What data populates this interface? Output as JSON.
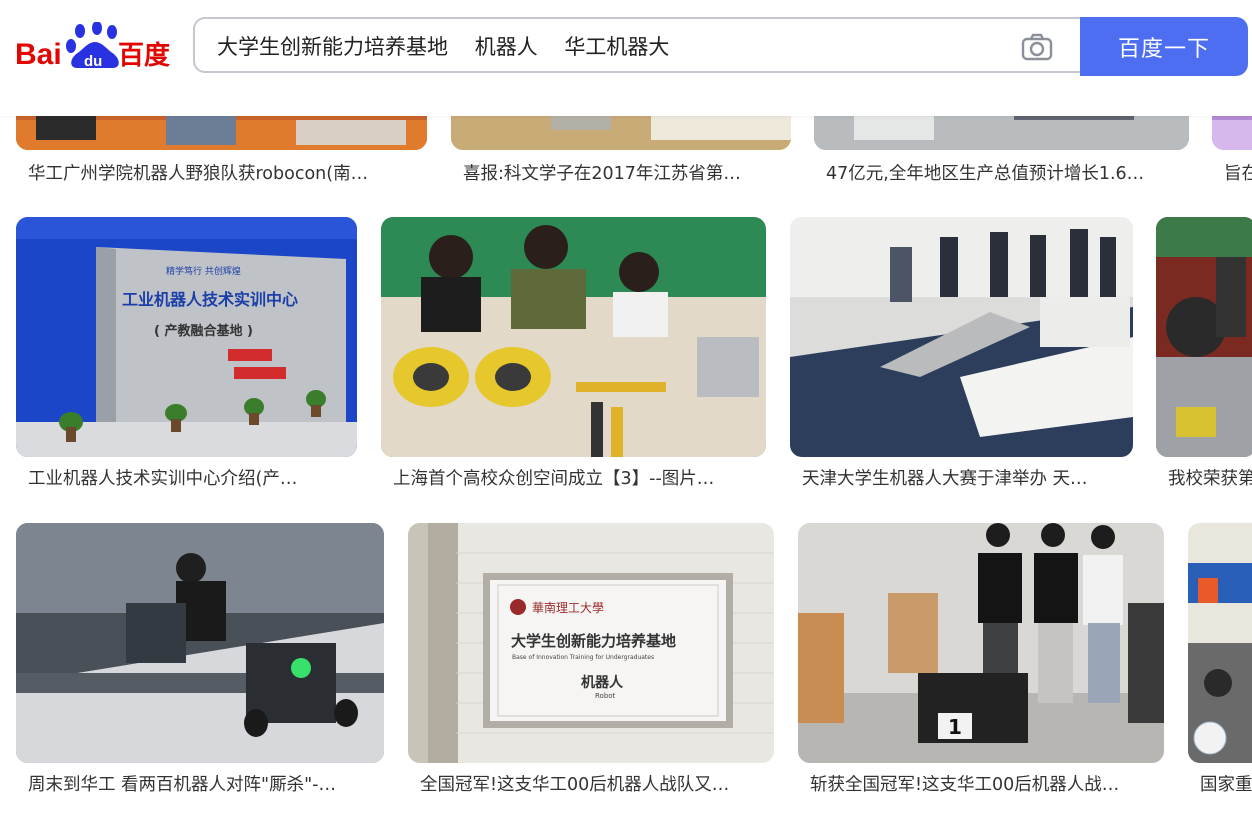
{
  "header": {
    "logo_text_left": "Bai",
    "logo_text_du": "du",
    "logo_text_right": "百度",
    "query": "大学生创新能力培养基地    机器人    华工机器大",
    "search_button": "百度一下",
    "camera_icon": "camera-icon"
  },
  "row1": [
    {
      "caption": "华工广州学院机器人野狼队获robocon(南…"
    },
    {
      "caption": "喜报:科文学子在2017年江苏省第…"
    },
    {
      "caption": "47亿元,全年地区生产总值预计增长1.6…"
    },
    {
      "caption": "旨在"
    }
  ],
  "row2": [
    {
      "caption": "工业机器人技术实训中心介绍(产…",
      "sign_line1": "工业机器人技术实训中心",
      "sign_line2": "( 产教融合基地 )",
      "sign_top": "精学笃行  共创辉煌"
    },
    {
      "caption": "上海首个高校众创空间成立【3】--图片…"
    },
    {
      "caption": "天津大学生机器人大赛于津举办 天…"
    },
    {
      "caption": "我校荣获第"
    }
  ],
  "row3": [
    {
      "caption": "周末到华工 看两百机器人对阵\"厮杀\"-…"
    },
    {
      "caption": "全国冠军!这支华工00后机器人战队又…",
      "plaque_school": "華南理工大學",
      "plaque_title": "大学生创新能力培养基地",
      "plaque_sub": "Base of Innovation Training for Undergraduates",
      "plaque_robot": "机器人",
      "plaque_robot_en": "Robot"
    },
    {
      "caption": "斩获全国冠军!这支华工00后机器人战…",
      "robot_number": "1"
    },
    {
      "caption": "国家重"
    }
  ]
}
